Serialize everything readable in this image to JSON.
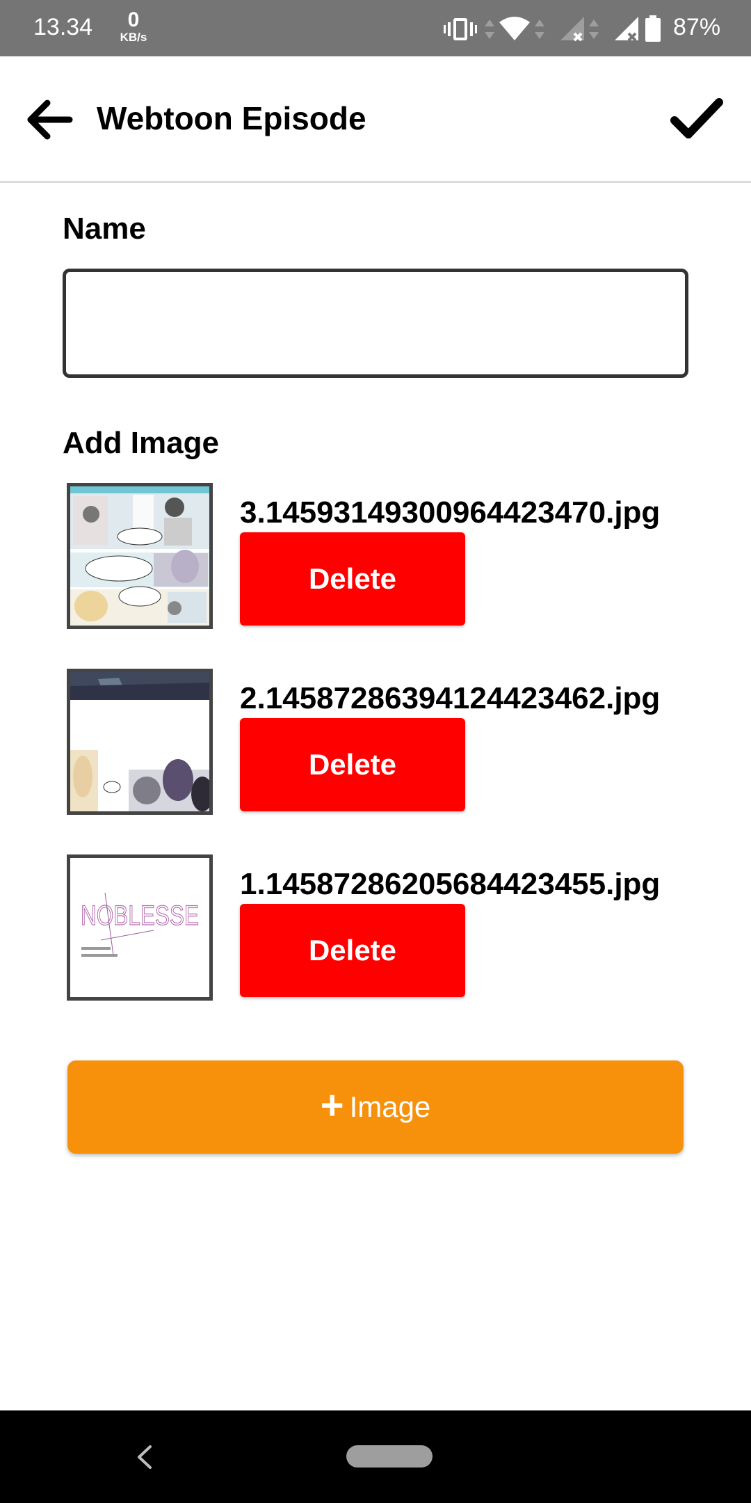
{
  "status_bar": {
    "time": "13.34",
    "net_speed_value": "0",
    "net_speed_unit": "KB/s",
    "icons": [
      "vibrate-icon",
      "data-arrows-icon",
      "wifi-icon",
      "signal-no-service-icon",
      "signal-no-service-icon",
      "battery-icon"
    ],
    "battery_percent": "87%"
  },
  "app_bar": {
    "title": "Webtoon Episode",
    "back_icon": "arrow-left-icon",
    "confirm_icon": "checkmark-icon"
  },
  "form": {
    "name_label": "Name",
    "name_value": "",
    "add_image_label": "Add Image",
    "images": [
      {
        "filename": "3.14593149300964423470.jpg",
        "delete_label": "Delete"
      },
      {
        "filename": "2.14587286394124423462.jpg",
        "delete_label": "Delete"
      },
      {
        "filename": "1.14587286205684423455.jpg",
        "delete_label": "Delete"
      }
    ],
    "add_button_icon": "plus-icon",
    "add_button_label": "Image",
    "thumbnail_3_title": "NOBLESSE"
  },
  "colors": {
    "delete": "#ff0000",
    "add_button": "#f7900a",
    "status_bar": "#757575",
    "nav_bar": "#000000"
  }
}
